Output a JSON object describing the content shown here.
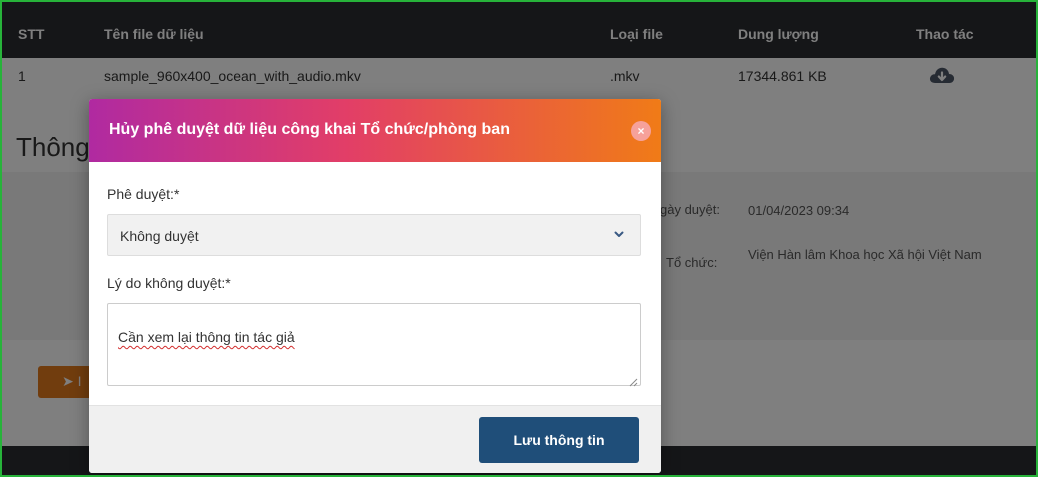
{
  "table": {
    "headers": [
      "STT",
      "Tên file dữ liệu",
      "Loại file",
      "Dung lượng",
      "Thao tác"
    ],
    "rows": [
      {
        "stt": "1",
        "file_name": "sample_960x400_ocean_with_audio.mkv",
        "file_type": ".mkv",
        "size": "17344.861 KB",
        "action_icon": "cloud-download-icon"
      }
    ]
  },
  "section": {
    "title": "Thông"
  },
  "info": {
    "approval_date_label": "gày duyệt:",
    "approval_date_value": "01/04/2023 09:34",
    "org_label": "Tổ chức:",
    "org_value": "Viện Hàn lâm Khoa học Xã hội Việt Nam"
  },
  "back_button": {
    "label": "➤ I"
  },
  "modal": {
    "title": "Hủy phê duyệt dữ liệu công khai Tổ chức/phòng ban",
    "close_symbol": "×",
    "approval": {
      "label": "Phê duyệt:*",
      "selected": "Không duyệt"
    },
    "reason": {
      "label": "Lý do không duyệt:*",
      "value": "Cần xem lại thông tin tác giả"
    },
    "save_label": "Lưu thông tin"
  },
  "colors": {
    "header_gradient": [
      "#b02aa1",
      "#e23e67",
      "#f07b17"
    ],
    "primary_button": "#1f4e79",
    "accent_orange": "#e37a1d",
    "frame_border": "#27b33a"
  }
}
